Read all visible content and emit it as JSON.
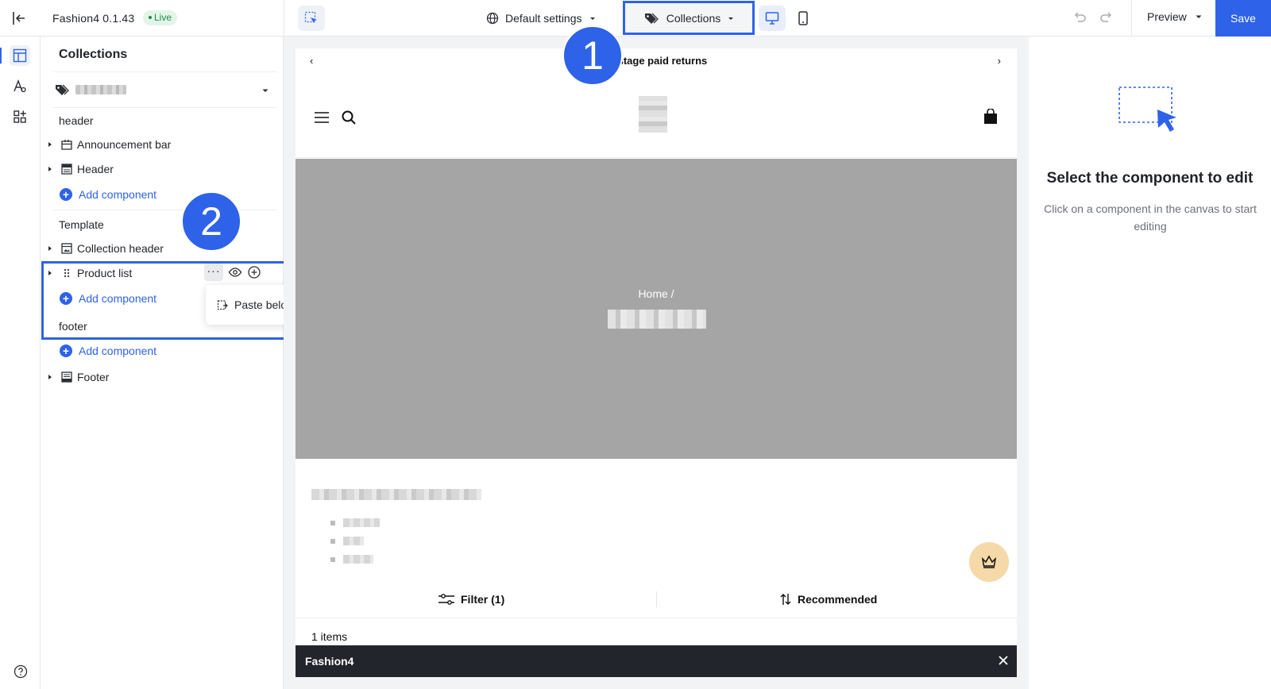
{
  "app": {
    "name": "Fashion4 0.1.43",
    "status": "Live"
  },
  "toolbar": {
    "default_settings": "Default settings",
    "page_selector": "Collections",
    "preview": "Preview",
    "save": "Save"
  },
  "panel": {
    "title": "Collections",
    "groups": [
      {
        "label": "header",
        "items": [
          {
            "label": "Announcement bar"
          },
          {
            "label": "Header"
          }
        ],
        "add_label": "Add component"
      },
      {
        "label": "Template",
        "items": [
          {
            "label": "Collection header"
          },
          {
            "label": "Product list"
          }
        ],
        "add_label": "Add component"
      },
      {
        "label": "footer",
        "items": [
          {
            "label": "Footer"
          }
        ],
        "add_label": "Add component"
      }
    ],
    "more_actions": "···",
    "context_menu": {
      "paste_below": "Paste below"
    }
  },
  "annotations": {
    "step1": "1",
    "step2": "2",
    "color": "#2e62e9"
  },
  "preview": {
    "announcement": "postage paid returns",
    "breadcrumb": "Home  /",
    "filter": "Filter  (1)",
    "sort": "Recommended",
    "items_count": "1 items",
    "bottom_bar": "Fashion4"
  },
  "inspector": {
    "title": "Select the component to edit",
    "subtitle": "Click on a component in the canvas to start editing"
  },
  "colors": {
    "accent": "#2e62e9",
    "hero": "#a5a5a5",
    "live_badge": "#1f8b4c"
  }
}
